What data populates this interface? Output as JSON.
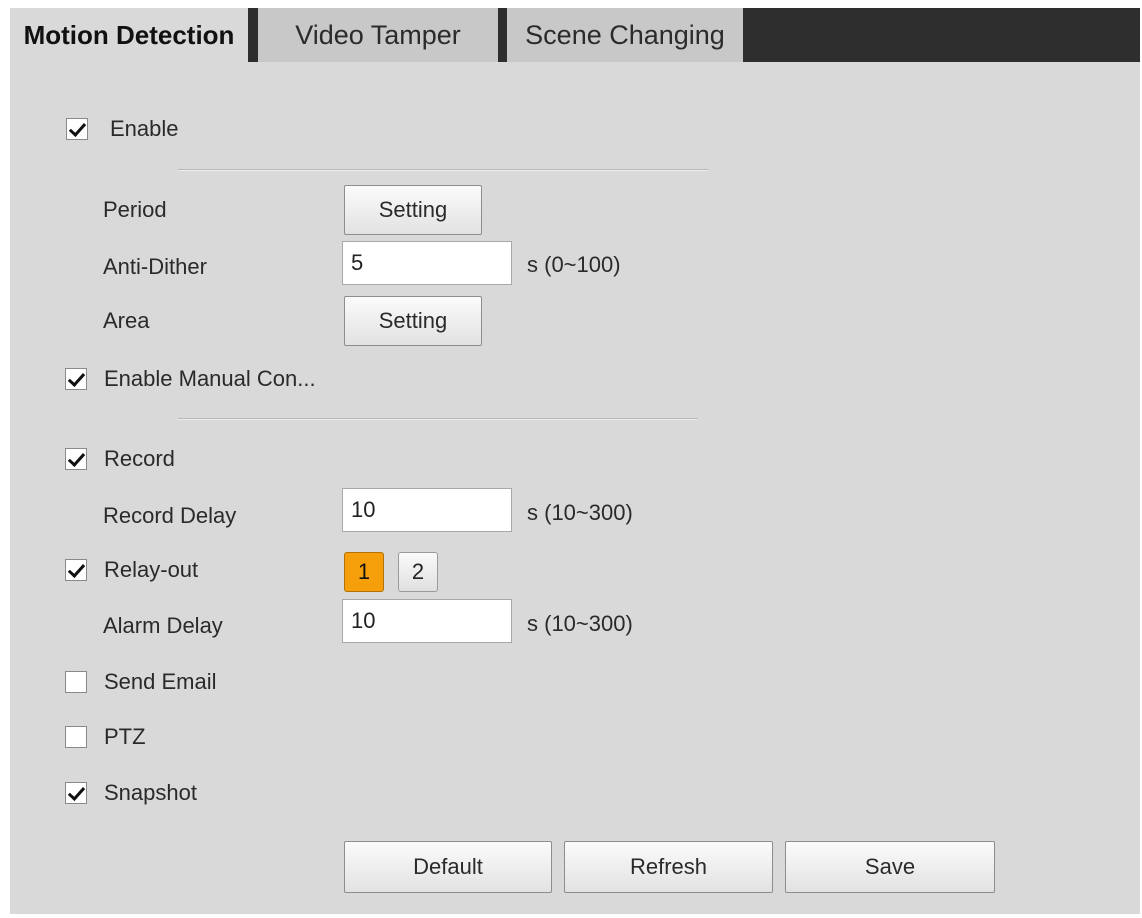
{
  "tabs": [
    {
      "label": "Motion Detection",
      "active": true
    },
    {
      "label": "Video Tamper",
      "active": false
    },
    {
      "label": "Scene Changing",
      "active": false
    }
  ],
  "enable": {
    "label": "Enable",
    "checked": true
  },
  "period": {
    "label": "Period",
    "button": "Setting"
  },
  "anti_dither": {
    "label": "Anti-Dither",
    "value": "5",
    "unit": "s (0~100)"
  },
  "area": {
    "label": "Area",
    "button": "Setting"
  },
  "manual_control": {
    "label": "Enable Manual Con...",
    "checked": true
  },
  "record": {
    "label": "Record",
    "checked": true
  },
  "record_delay": {
    "label": "Record Delay",
    "value": "10",
    "unit": "s (10~300)"
  },
  "relay_out": {
    "label": "Relay-out",
    "checked": true,
    "channels": [
      "1",
      "2"
    ],
    "selected": "1"
  },
  "alarm_delay": {
    "label": "Alarm Delay",
    "value": "10",
    "unit": "s (10~300)"
  },
  "send_email": {
    "label": "Send Email",
    "checked": false
  },
  "ptz": {
    "label": "PTZ",
    "checked": false
  },
  "snapshot": {
    "label": "Snapshot",
    "checked": true
  },
  "actions": {
    "default": "Default",
    "refresh": "Refresh",
    "save": "Save"
  },
  "colors": {
    "panel": "#d9d9d9",
    "tabbar": "#2e2e2e",
    "relay_selected": "#f5a00a"
  }
}
